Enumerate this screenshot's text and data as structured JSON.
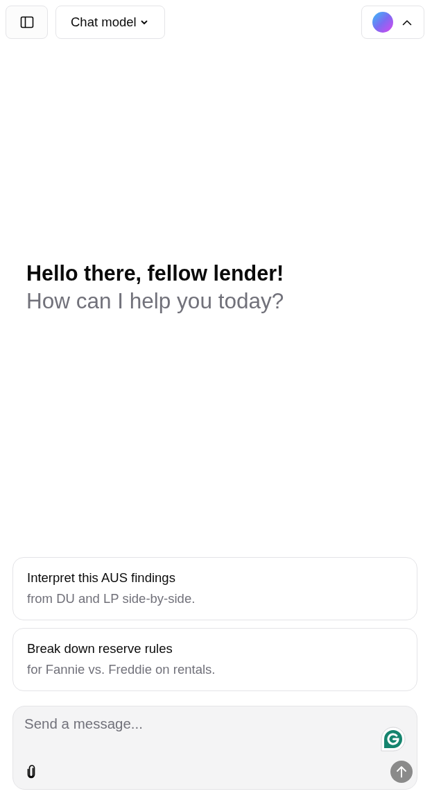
{
  "header": {
    "model_selector": "Chat model"
  },
  "greeting": {
    "title": "Hello there, fellow lender!",
    "subtitle": "How can I help you today?"
  },
  "suggestions": [
    {
      "title": "Interpret this AUS findings",
      "detail": "from DU and LP side-by-side."
    },
    {
      "title": "Break down reserve rules",
      "detail": "for Fannie vs. Freddie on rentals."
    }
  ],
  "composer": {
    "placeholder": "Send a message...",
    "send_disabled": true
  }
}
